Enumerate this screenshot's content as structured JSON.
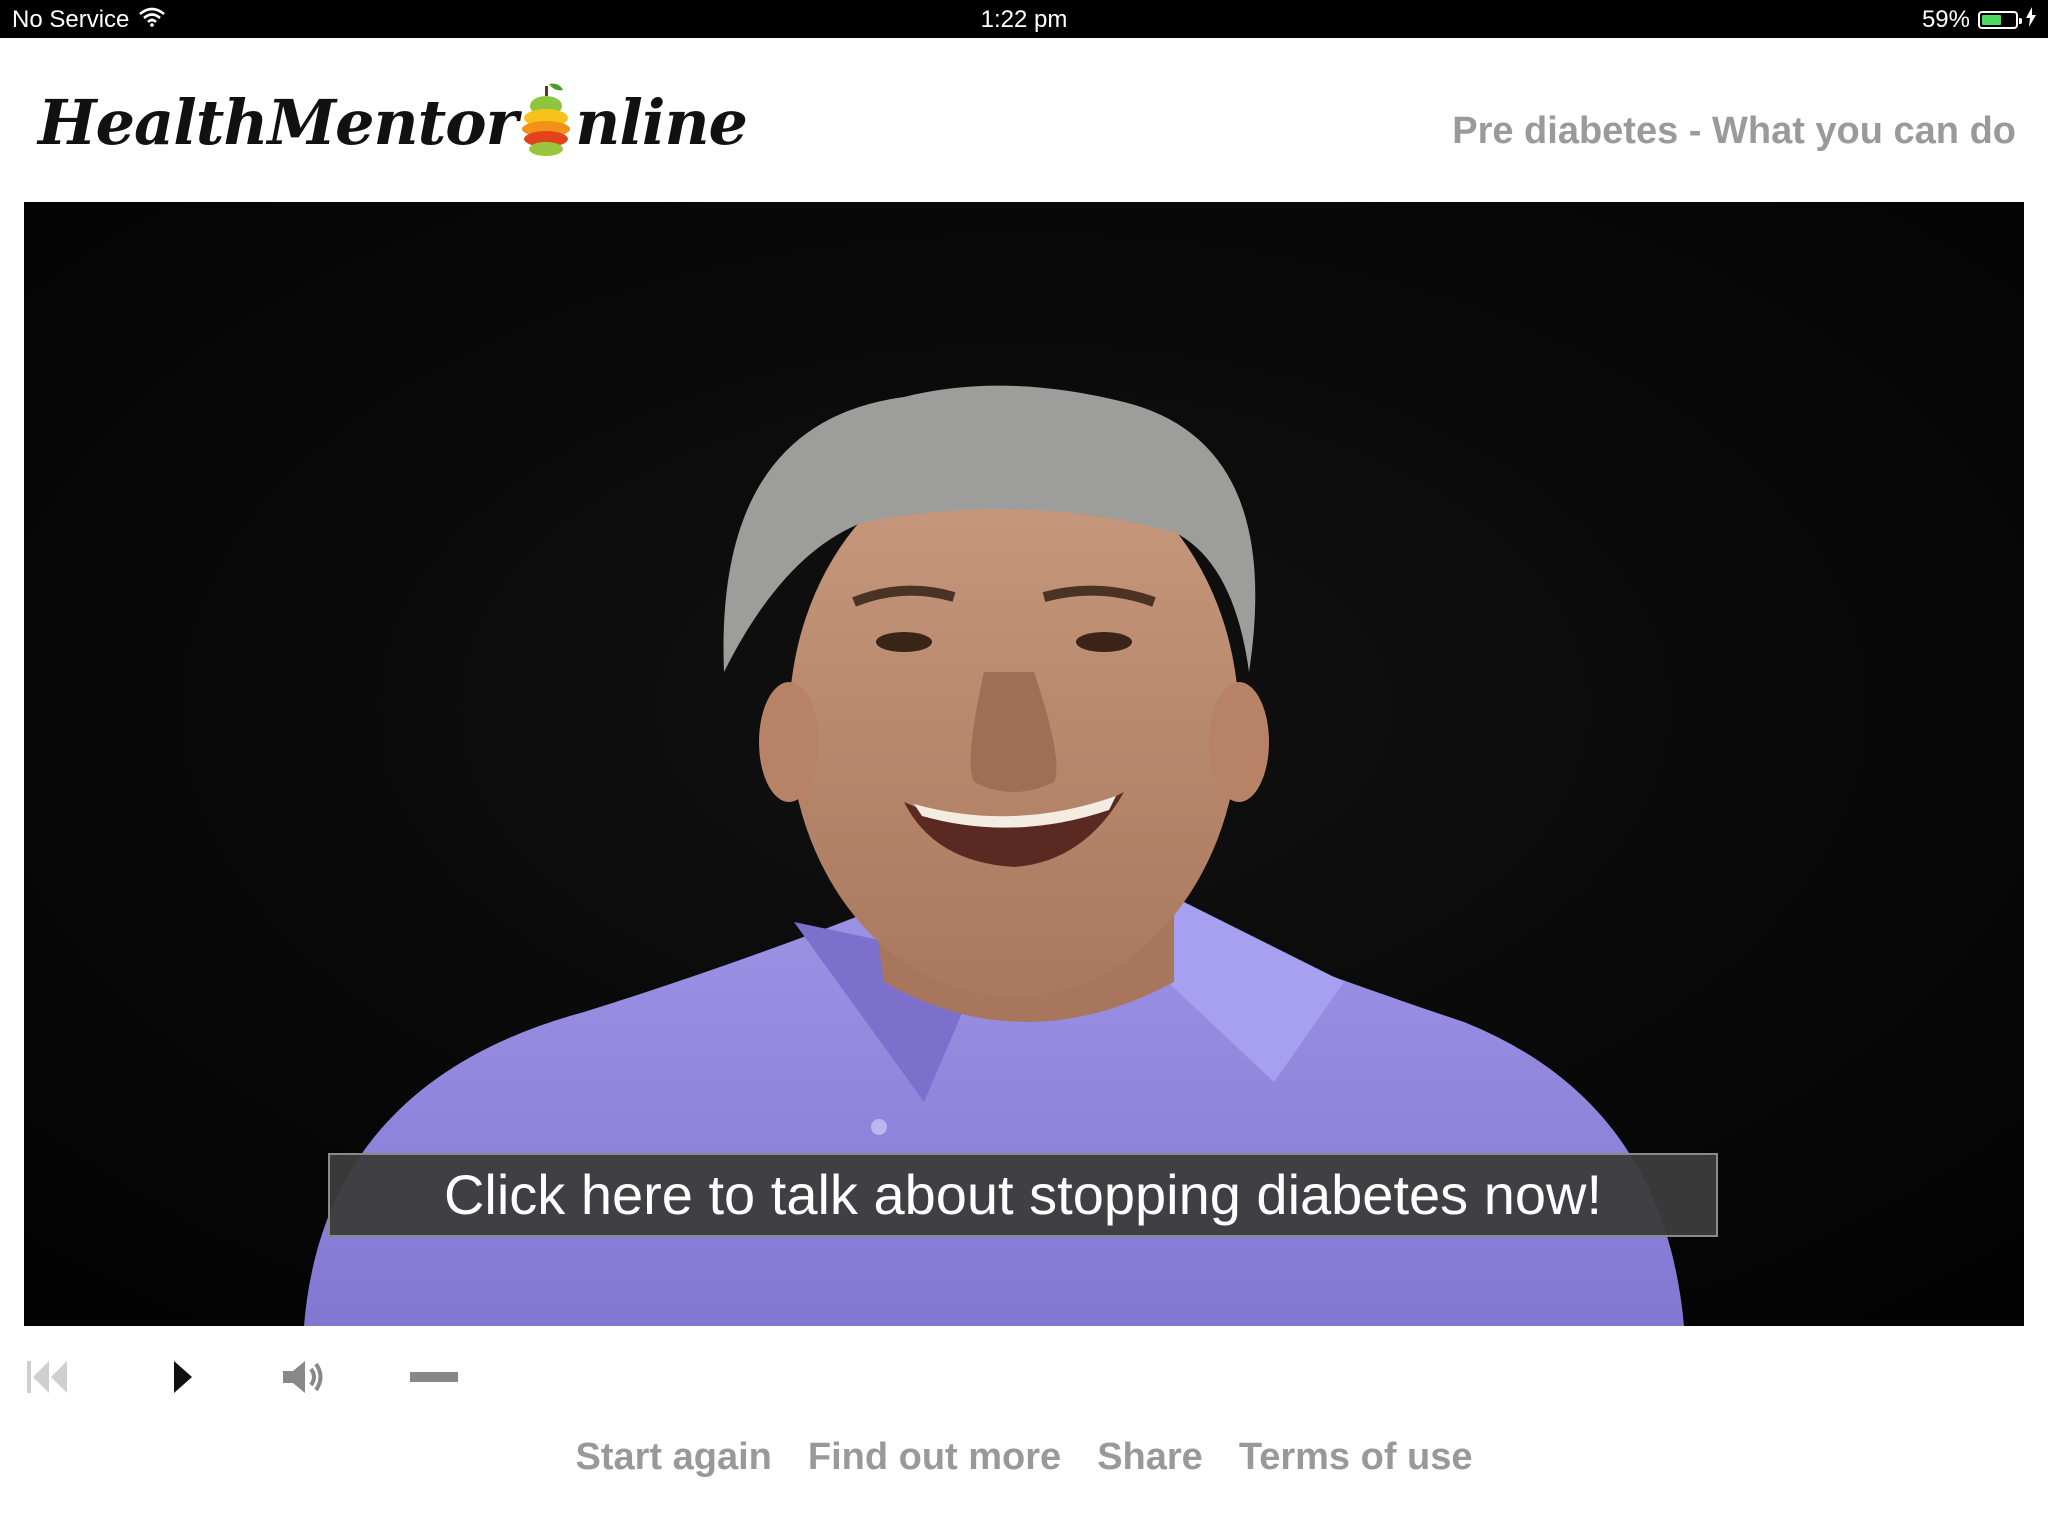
{
  "status_bar": {
    "carrier": "No Service",
    "time": "1:22 pm",
    "battery_percent": "59%",
    "battery_level": 0.59
  },
  "header": {
    "logo_part1": "HealthMentor",
    "logo_part2": "nline",
    "page_title": "Pre diabetes - What you can do"
  },
  "video": {
    "cta_label": "Click here to talk about stopping diabetes now!"
  },
  "player": {
    "controls": [
      "restart-icon",
      "play-icon",
      "volume-icon",
      "minus-icon"
    ]
  },
  "footer": {
    "links": [
      "Start again",
      "Find out more",
      "Share",
      "Terms of use"
    ]
  },
  "colors": {
    "muted_text": "#999999",
    "battery_green": "#4cd964",
    "shirt": "#9a8fe0"
  }
}
